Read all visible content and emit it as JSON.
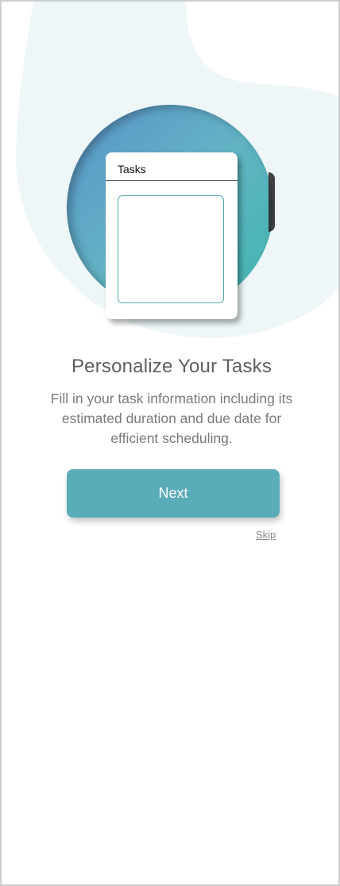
{
  "hero": {
    "card_title": "Tasks"
  },
  "content": {
    "heading": "Personalize Your Tasks",
    "description": "Fill in your task information including its estimated duration and due date for efficient scheduling."
  },
  "actions": {
    "next_label": "Next",
    "skip_label": "Skip"
  },
  "colors": {
    "accent": "#5aacb8",
    "background_blob": "#eef6f8",
    "heading_text": "#5f5f5f",
    "body_text": "#7a7a7a"
  }
}
